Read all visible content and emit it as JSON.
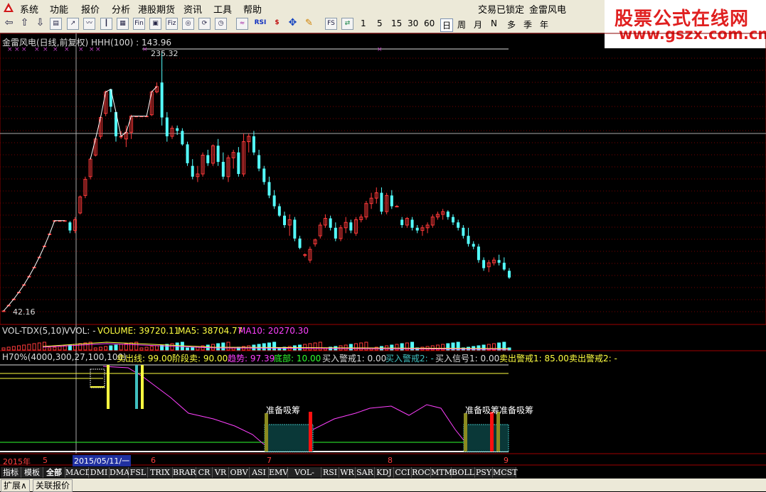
{
  "menu": {
    "items": [
      "系统",
      "功能",
      "报价",
      "分析",
      "港股期货",
      "资讯",
      "工具",
      "帮助"
    ],
    "right_status": "交易已锁定",
    "right_stock": "金雷风电"
  },
  "toolbar": {
    "icons": [
      "back-icon",
      "up-icon",
      "down-icon",
      "page-icon",
      "chart-icon",
      "line-icon",
      "bar-icon",
      "grid-icon",
      "fin-icon",
      "f10-icon",
      "fiz-icon",
      "circle-icon",
      "refresh-icon",
      "wave-icon",
      "rsi-icon",
      "dollar-icon",
      "move-icon",
      "pen-icon",
      "fs-icon",
      "switch-icon"
    ],
    "rsi_label": "RSI",
    "fin_label": "Fin",
    "fiz_label": "Fiz",
    "fs_label": "FS",
    "periods": [
      "1",
      "5",
      "15",
      "30",
      "60",
      "日",
      "周",
      "月",
      "N",
      "多",
      "季",
      "年"
    ],
    "selected_period": "日"
  },
  "brand": {
    "line1": "股票公式在线网",
    "line2": "www.gszx.com.cn",
    "color": "#e02020"
  },
  "main_chart": {
    "title": "金雷风电(日线,前复权) HHH(100) : 143.96",
    "high_label": "235.32",
    "low_label": "42.16",
    "up_color": "#ff3a3a",
    "down_color": "#54ffff",
    "candles": [
      {
        "o": 42.2,
        "h": 42.2,
        "l": 42.16,
        "c": 42.2
      },
      {
        "o": 46.4,
        "h": 46.4,
        "l": 46.4,
        "c": 46.4
      },
      {
        "o": 51.0,
        "h": 51.0,
        "l": 51.0,
        "c": 51.0
      },
      {
        "o": 56.1,
        "h": 56.1,
        "l": 56.1,
        "c": 56.1
      },
      {
        "o": 61.7,
        "h": 61.7,
        "l": 61.7,
        "c": 61.7
      },
      {
        "o": 67.9,
        "h": 67.9,
        "l": 67.9,
        "c": 67.9
      },
      {
        "o": 74.7,
        "h": 74.7,
        "l": 74.7,
        "c": 74.7
      },
      {
        "o": 82.2,
        "h": 82.2,
        "l": 82.2,
        "c": 82.2
      },
      {
        "o": 90.4,
        "h": 90.4,
        "l": 90.4,
        "c": 90.4
      },
      {
        "o": 99.4,
        "h": 99.4,
        "l": 99.4,
        "c": 99.4
      },
      {
        "o": 109.3,
        "h": 109.3,
        "l": 109.3,
        "c": 109.3
      },
      {
        "o": 109.3,
        "h": 109.3,
        "l": 109.3,
        "c": 109.3
      },
      {
        "o": 109.3,
        "h": 109.3,
        "l": 109.3,
        "c": 109.3
      },
      {
        "o": 108,
        "h": 109,
        "l": 100,
        "c": 102
      },
      {
        "o": 102,
        "h": 112,
        "l": 100,
        "c": 110
      },
      {
        "o": 115,
        "h": 128,
        "l": 114,
        "c": 127
      },
      {
        "o": 128,
        "h": 142,
        "l": 126,
        "c": 140
      },
      {
        "o": 142,
        "h": 156,
        "l": 140,
        "c": 155
      },
      {
        "o": 158,
        "h": 171,
        "l": 157,
        "c": 170
      },
      {
        "o": 172,
        "h": 187,
        "l": 170,
        "c": 186
      },
      {
        "o": 189,
        "h": 206,
        "l": 187,
        "c": 205
      },
      {
        "o": 207,
        "h": 207,
        "l": 190,
        "c": 194
      },
      {
        "o": 190,
        "h": 190,
        "l": 168,
        "c": 172
      },
      {
        "o": 172,
        "h": 176,
        "l": 170,
        "c": 172
      },
      {
        "o": 170,
        "h": 180,
        "l": 164,
        "c": 175
      },
      {
        "o": 175,
        "h": 188,
        "l": 170,
        "c": 187
      },
      {
        "o": 187,
        "h": 187,
        "l": 187,
        "c": 187
      },
      {
        "o": 187,
        "h": 187,
        "l": 187,
        "c": 187
      },
      {
        "o": 187,
        "h": 187,
        "l": 187,
        "c": 187
      },
      {
        "o": 188,
        "h": 206,
        "l": 187,
        "c": 205
      },
      {
        "o": 205,
        "h": 212,
        "l": 204,
        "c": 209
      },
      {
        "o": 212,
        "h": 235.32,
        "l": 180,
        "c": 186
      },
      {
        "o": 186,
        "h": 190,
        "l": 168,
        "c": 172
      },
      {
        "o": 172,
        "h": 180,
        "l": 170,
        "c": 178
      },
      {
        "o": 178,
        "h": 180,
        "l": 173,
        "c": 176
      },
      {
        "o": 176,
        "h": 178,
        "l": 165,
        "c": 166
      },
      {
        "o": 166,
        "h": 168,
        "l": 150,
        "c": 152
      },
      {
        "o": 150,
        "h": 155,
        "l": 140,
        "c": 142
      },
      {
        "o": 142,
        "h": 150,
        "l": 138,
        "c": 144
      },
      {
        "o": 144,
        "h": 160,
        "l": 142,
        "c": 158
      },
      {
        "o": 158,
        "h": 162,
        "l": 150,
        "c": 152
      },
      {
        "o": 152,
        "h": 166,
        "l": 150,
        "c": 165
      },
      {
        "o": 165,
        "h": 170,
        "l": 150,
        "c": 153
      },
      {
        "o": 153,
        "h": 160,
        "l": 140,
        "c": 142
      },
      {
        "o": 142,
        "h": 158,
        "l": 138,
        "c": 156
      },
      {
        "o": 156,
        "h": 162,
        "l": 148,
        "c": 160
      },
      {
        "o": 160,
        "h": 164,
        "l": 142,
        "c": 144
      },
      {
        "o": 144,
        "h": 174,
        "l": 142,
        "c": 168
      },
      {
        "o": 168,
        "h": 174,
        "l": 160,
        "c": 172
      },
      {
        "o": 172,
        "h": 176,
        "l": 158,
        "c": 160
      },
      {
        "o": 158,
        "h": 162,
        "l": 146,
        "c": 148
      },
      {
        "o": 148,
        "h": 150,
        "l": 136,
        "c": 138
      },
      {
        "o": 138,
        "h": 142,
        "l": 126,
        "c": 128
      },
      {
        "o": 128,
        "h": 132,
        "l": 118,
        "c": 120
      },
      {
        "o": 120,
        "h": 122,
        "l": 112,
        "c": 113
      },
      {
        "o": 113,
        "h": 116,
        "l": 104,
        "c": 106
      },
      {
        "o": 106,
        "h": 114,
        "l": 98,
        "c": 110
      },
      {
        "o": 110,
        "h": 112,
        "l": 94,
        "c": 96
      },
      {
        "o": 96,
        "h": 98,
        "l": 88,
        "c": 89
      },
      {
        "o": 84,
        "h": 85,
        "l": 82,
        "c": 84
      },
      {
        "o": 80,
        "h": 90,
        "l": 78,
        "c": 88
      },
      {
        "o": 92,
        "h": 96,
        "l": 90,
        "c": 95
      },
      {
        "o": 98,
        "h": 108,
        "l": 96,
        "c": 106
      },
      {
        "o": 106,
        "h": 114,
        "l": 104,
        "c": 111
      },
      {
        "o": 111,
        "h": 113,
        "l": 102,
        "c": 104
      },
      {
        "o": 104,
        "h": 108,
        "l": 94,
        "c": 96
      },
      {
        "o": 96,
        "h": 106,
        "l": 94,
        "c": 104
      },
      {
        "o": 104,
        "h": 112,
        "l": 100,
        "c": 108
      },
      {
        "o": 108,
        "h": 110,
        "l": 100,
        "c": 102
      },
      {
        "o": 100,
        "h": 112,
        "l": 98,
        "c": 110
      },
      {
        "o": 110,
        "h": 114,
        "l": 108,
        "c": 112
      },
      {
        "o": 112,
        "h": 124,
        "l": 110,
        "c": 122
      },
      {
        "o": 122,
        "h": 130,
        "l": 118,
        "c": 126
      },
      {
        "o": 126,
        "h": 134,
        "l": 122,
        "c": 130
      },
      {
        "o": 130,
        "h": 134,
        "l": 114,
        "c": 116
      },
      {
        "o": 116,
        "h": 130,
        "l": 114,
        "c": 128
      },
      {
        "o": 128,
        "h": 132,
        "l": 118,
        "c": 120
      },
      {
        "o": 120,
        "h": 121,
        "l": 120,
        "c": 120
      },
      {
        "o": 110,
        "h": 112,
        "l": 104,
        "c": 106
      },
      {
        "o": 106,
        "h": 112,
        "l": 104,
        "c": 111
      },
      {
        "o": 110,
        "h": 112,
        "l": 102,
        "c": 104
      },
      {
        "o": 104,
        "h": 106,
        "l": 100,
        "c": 102
      },
      {
        "o": 102,
        "h": 106,
        "l": 98,
        "c": 104
      },
      {
        "o": 104,
        "h": 108,
        "l": 100,
        "c": 106
      },
      {
        "o": 106,
        "h": 114,
        "l": 104,
        "c": 112
      },
      {
        "o": 112,
        "h": 116,
        "l": 110,
        "c": 114
      },
      {
        "o": 114,
        "h": 118,
        "l": 110,
        "c": 116
      },
      {
        "o": 116,
        "h": 117,
        "l": 110,
        "c": 112
      },
      {
        "o": 112,
        "h": 114,
        "l": 106,
        "c": 108
      },
      {
        "o": 108,
        "h": 110,
        "l": 102,
        "c": 104
      },
      {
        "o": 104,
        "h": 106,
        "l": 96,
        "c": 98
      },
      {
        "o": 98,
        "h": 104,
        "l": 90,
        "c": 92
      },
      {
        "o": 92,
        "h": 94,
        "l": 88,
        "c": 90
      },
      {
        "o": 90,
        "h": 92,
        "l": 78,
        "c": 80
      },
      {
        "o": 80,
        "h": 82,
        "l": 72,
        "c": 74
      },
      {
        "o": 75,
        "h": 80,
        "l": 71,
        "c": 78
      },
      {
        "o": 78,
        "h": 82,
        "l": 76,
        "c": 80
      },
      {
        "o": 80,
        "h": 84,
        "l": 76,
        "c": 78
      },
      {
        "o": 78,
        "h": 82,
        "l": 72,
        "c": 73
      },
      {
        "o": 72,
        "h": 74,
        "l": 66,
        "c": 67
      }
    ]
  },
  "volume_panel": {
    "title": "VOL-TDX(5,10)",
    "vol_label": "VVOL: -",
    "volume": "VOLUME: 39720.11",
    "ma5": "MA5: 38704.77",
    "ma10": "MA10: 20270.30"
  },
  "indicator_panel": {
    "title": "H70%(4000,300,27,100,100)",
    "sell_line": "卖出线: 99.00",
    "stage_sell": "阶段卖: 90.00",
    "trend": "趋势: 97.39",
    "bottom": "底部: 10.00",
    "buy_alert1": "买入警戒1: 0.00",
    "buy_alert2": "买入警戒2: -",
    "buy_signal1": "买入信号1: 0.00",
    "sell_alert1": "卖出警戒1: 85.00",
    "sell_alert2": "卖出警戒2: -",
    "absorb_label": "准备吸筹"
  },
  "time_axis": {
    "year": "2015年",
    "m5": "5",
    "selected_date": "2015/05/11/一",
    "m6": "6",
    "m7": "7",
    "m8": "8",
    "m9": "9"
  },
  "bottom_tabs": [
    "指标",
    "模板",
    "全部",
    "MACD",
    "DMI",
    "DMA",
    "FSL",
    "TRIX",
    "BRAR",
    "CR",
    "VR",
    "OBV",
    "ASI",
    "EMV",
    "VOL-TDX",
    "RSI",
    "WR",
    "SAR",
    "KDJ",
    "CCI",
    "ROC",
    "MTM",
    "BOLL",
    "PSY",
    "MCST"
  ],
  "selected_tab": "全部",
  "status_bar": {
    "expand": "扩展∧",
    "linked": "关联报价"
  }
}
